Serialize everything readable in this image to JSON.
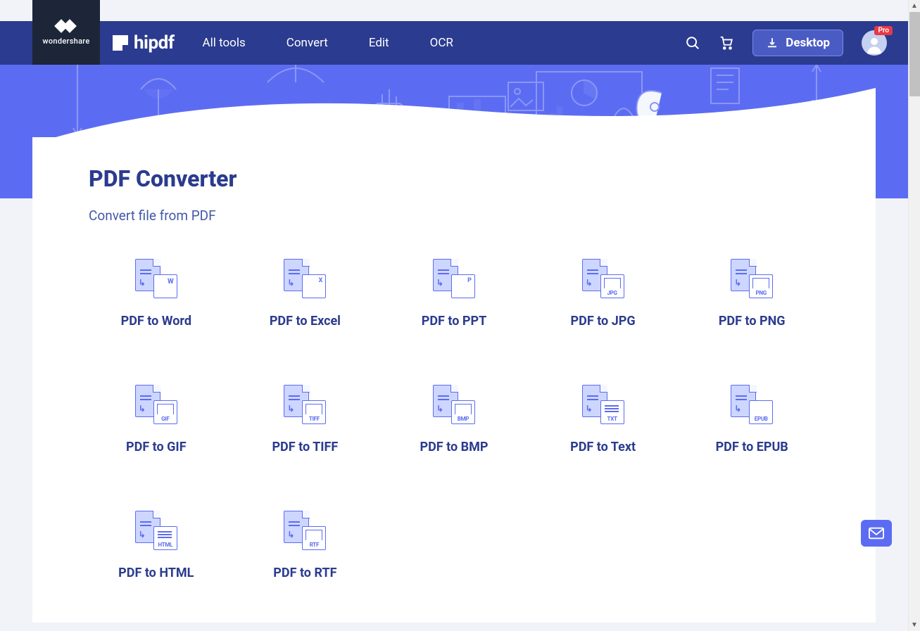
{
  "brand": {
    "parent": "wondershare",
    "name": "hipdf"
  },
  "nav": {
    "items": [
      "All tools",
      "Convert",
      "Edit",
      "OCR"
    ],
    "desktop_label": "Desktop",
    "pro_badge": "Pro"
  },
  "page": {
    "title": "PDF Converter",
    "subtitle": "Convert file from PDF"
  },
  "tools": [
    {
      "label": "PDF to Word",
      "ext": "",
      "variant": "w"
    },
    {
      "label": "PDF to Excel",
      "ext": "",
      "variant": "x"
    },
    {
      "label": "PDF to PPT",
      "ext": "",
      "variant": "p"
    },
    {
      "label": "PDF to JPG",
      "ext": "JPG",
      "variant": "img"
    },
    {
      "label": "PDF to PNG",
      "ext": "PNG",
      "variant": "img"
    },
    {
      "label": "PDF to GIF",
      "ext": "GIF",
      "variant": "img"
    },
    {
      "label": "PDF to TIFF",
      "ext": "TIFF",
      "variant": "img"
    },
    {
      "label": "PDF to BMP",
      "ext": "BMP",
      "variant": "img"
    },
    {
      "label": "PDF to Text",
      "ext": "TXT",
      "variant": "txt-lines"
    },
    {
      "label": "PDF to EPUB",
      "ext": "EPUB",
      "variant": ""
    },
    {
      "label": "PDF to HTML",
      "ext": "HTML",
      "variant": "txt-lines"
    },
    {
      "label": "PDF to RTF",
      "ext": "RTF",
      "variant": "img"
    }
  ]
}
